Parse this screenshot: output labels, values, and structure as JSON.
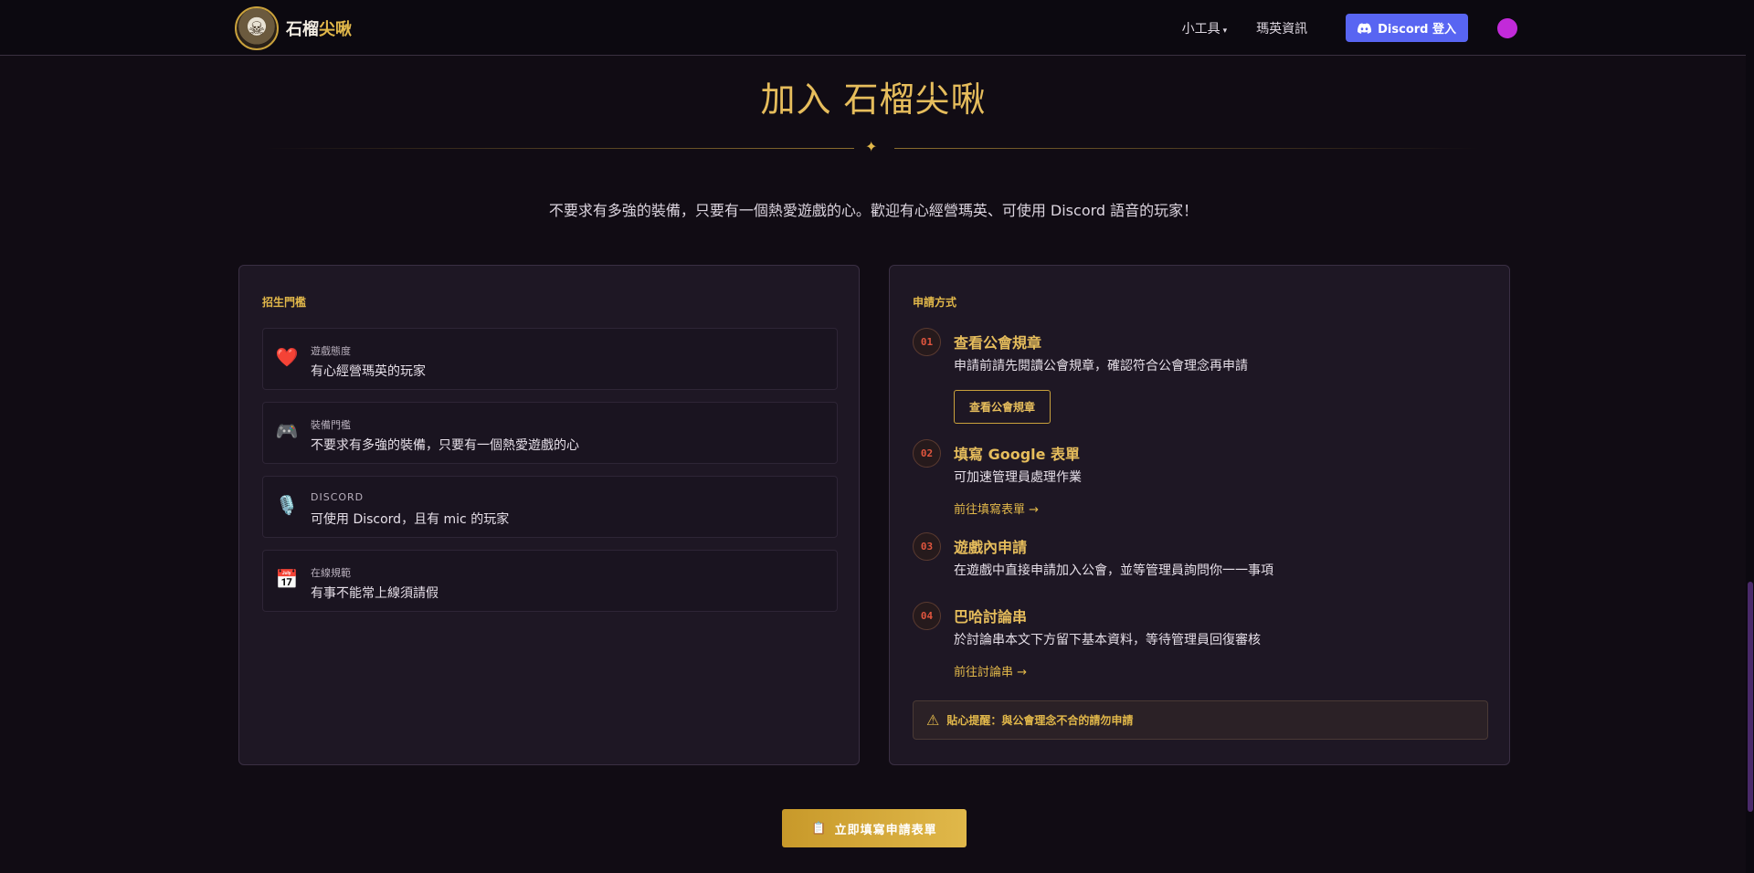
{
  "nav": {
    "logo_text_main": "石榴",
    "logo_text_accent": "尖啾",
    "tools_label": "小工具",
    "maple_info_label": "瑪英資訊",
    "discord_login_label": "Discord 登入"
  },
  "hero": {
    "title": "加入 石榴尖啾",
    "intro": "不要求有多強的裝備，只要有一個熱愛遊戲的心。歡迎有心經營瑪英、可使用 Discord 語音的玩家！"
  },
  "requirements": {
    "heading": "招生門檻",
    "items": [
      {
        "icon": "heart-icon",
        "glyph": "❤️",
        "label": "遊戲態度",
        "value": "有心經營瑪英的玩家"
      },
      {
        "icon": "gamepad-icon",
        "glyph": "🎮",
        "label": "裝備門檻",
        "value": "不要求有多強的裝備，只要有一個熱愛遊戲的心"
      },
      {
        "icon": "microphone-icon",
        "glyph": "🎙️",
        "label": "DISCORD",
        "value": "可使用 Discord，且有 mic 的玩家"
      },
      {
        "icon": "calendar-icon",
        "glyph": "📅",
        "label": "在線規範",
        "value": "有事不能常上線須請假"
      }
    ]
  },
  "apply": {
    "heading": "申請方式",
    "steps": [
      {
        "num": "01",
        "title": "查看公會規章",
        "desc": "申請前請先閱讀公會規章，確認符合公會理念再申請",
        "button": "查看公會規章"
      },
      {
        "num": "02",
        "title": "填寫 Google 表單",
        "desc": "可加速管理員處理作業",
        "link": "前往填寫表單 →"
      },
      {
        "num": "03",
        "title": "遊戲內申請",
        "desc": "在遊戲中直接申請加入公會，並等管理員詢問你一一事項"
      },
      {
        "num": "04",
        "title": "巴哈討論串",
        "desc": "於討論串本文下方留下基本資料，等待管理員回復審核",
        "link": "前往討論串 →"
      }
    ],
    "tip": "貼心提醒：與公會理念不合的請勿申請"
  },
  "cta": {
    "label": "立即填寫申請表單"
  },
  "colors": {
    "accent": "#e2b84a",
    "discord": "#5865f2",
    "background": "#110c14",
    "card": "#1e1724",
    "step_number": "#e0553e"
  }
}
